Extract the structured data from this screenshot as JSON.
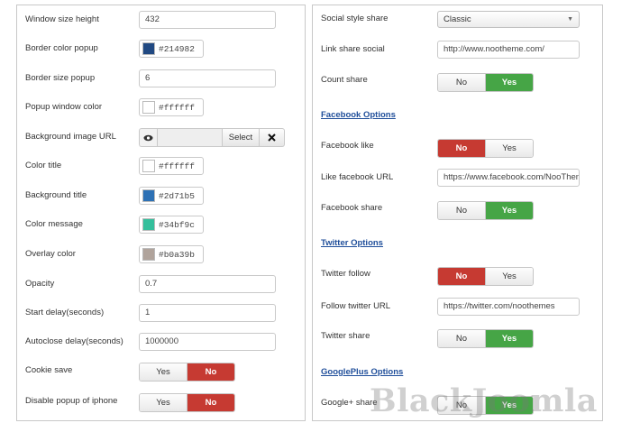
{
  "left": {
    "window_size_height": {
      "label": "Window size height",
      "value": "432"
    },
    "border_color_popup": {
      "label": "Border color popup",
      "hex": "#214982",
      "color": "#214982"
    },
    "border_size_popup": {
      "label": "Border size popup",
      "value": "6"
    },
    "popup_window_color": {
      "label": "Popup window color",
      "hex": "#ffffff",
      "color": "#ffffff"
    },
    "background_image_url": {
      "label": "Background image URL",
      "select_label": "Select",
      "preview_icon": "eye-icon",
      "clear_icon": "close-icon"
    },
    "color_title": {
      "label": "Color title",
      "hex": "#ffffff",
      "color": "#ffffff"
    },
    "background_title": {
      "label": "Background title",
      "hex": "#2d71b5",
      "color": "#2d71b5"
    },
    "color_message": {
      "label": "Color message",
      "hex": "#34bf9c",
      "color": "#34bf9c"
    },
    "overlay_color": {
      "label": "Overlay color",
      "hex": "#b0a39b",
      "color": "#b0a39b"
    },
    "opacity": {
      "label": "Opacity",
      "value": "0.7"
    },
    "start_delay": {
      "label": "Start delay(seconds)",
      "value": "1"
    },
    "autoclose_delay": {
      "label": "Autoclose delay(seconds)",
      "value": "1000000"
    },
    "cookie_save": {
      "label": "Cookie save",
      "yes": "Yes",
      "no": "No",
      "selected": "No"
    },
    "disable_popup_iphone": {
      "label": "Disable popup of iphone",
      "yes": "Yes",
      "no": "No",
      "selected": "No"
    }
  },
  "right": {
    "social_style_share": {
      "label": "Social style share",
      "value": "Classic"
    },
    "link_share_social": {
      "label": "Link share social",
      "value": "http://www.nootheme.com/"
    },
    "count_share": {
      "label": "Count share",
      "no": "No",
      "yes": "Yes",
      "selected": "Yes"
    },
    "facebook_section": "Facebook Options",
    "facebook_like": {
      "label": "Facebook like",
      "no": "No",
      "yes": "Yes",
      "selected": "No"
    },
    "like_facebook_url": {
      "label": "Like facebook URL",
      "value": "https://www.facebook.com/NooThen"
    },
    "facebook_share": {
      "label": "Facebook share",
      "no": "No",
      "yes": "Yes",
      "selected": "Yes"
    },
    "twitter_section": "Twitter Options",
    "twitter_follow": {
      "label": "Twitter follow",
      "no": "No",
      "yes": "Yes",
      "selected": "No"
    },
    "follow_twitter_url": {
      "label": "Follow twitter URL",
      "value": "https://twitter.com/noothemes"
    },
    "twitter_share": {
      "label": "Twitter share",
      "no": "No",
      "yes": "Yes",
      "selected": "Yes"
    },
    "googleplus_section": "GooglePlus Options",
    "google_share": {
      "label": "Google+ share",
      "no": "No",
      "yes": "Yes",
      "selected": "Yes"
    }
  },
  "watermark": "BlackJoomla",
  "colors": {
    "red": "#c63a32",
    "green": "#46a546",
    "section_link": "#1f4e9a"
  }
}
